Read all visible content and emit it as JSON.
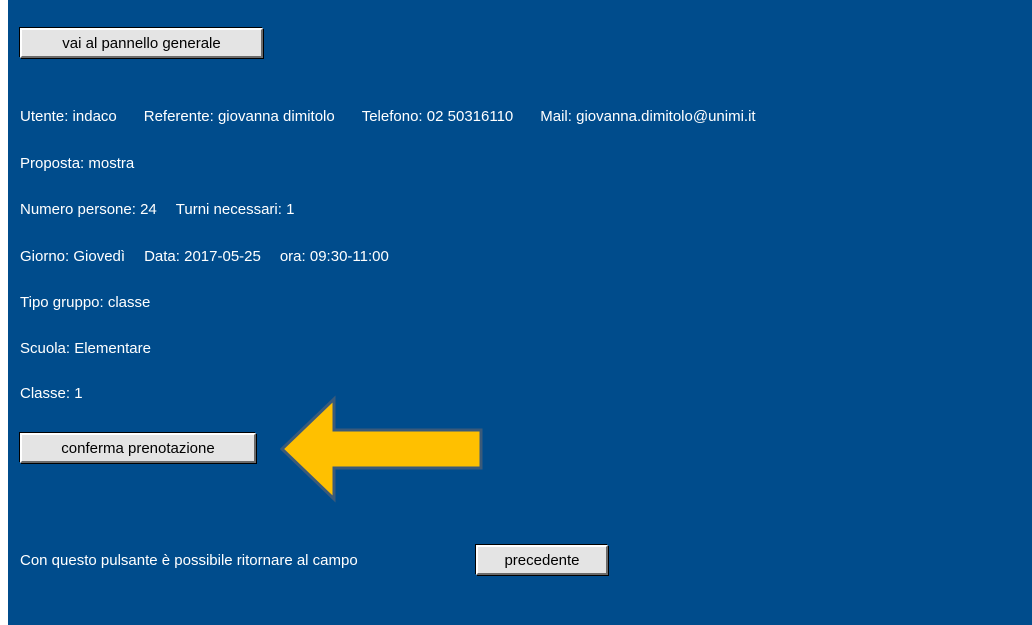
{
  "buttons": {
    "general_panel": "vai al pannello generale",
    "confirm": "conferma prenotazione",
    "previous": "precedente"
  },
  "info": {
    "utente": {
      "label": "Utente:",
      "value": "indaco"
    },
    "referente": {
      "label": "Referente:",
      "value": "giovanna dimitolo"
    },
    "telefono": {
      "label": "Telefono:",
      "value": "02 50316110"
    },
    "mail": {
      "label": "Mail:",
      "value": "giovanna.dimitolo@unimi.it"
    },
    "proposta": {
      "label": "Proposta:",
      "value": "mostra"
    },
    "numero_persone": {
      "label": "Numero persone:",
      "value": "24"
    },
    "turni": {
      "label": "Turni necessari:",
      "value": "1"
    },
    "giorno": {
      "label": "Giorno:",
      "value": "Giovedì"
    },
    "data": {
      "label": "Data:",
      "value": "2017-05-25"
    },
    "ora": {
      "label": "ora:",
      "value": "09:30-11:00"
    },
    "tipo_gruppo": {
      "label": "Tipo gruppo:",
      "value": "classe"
    },
    "scuola": {
      "label": "Scuola:",
      "value": "Elementare"
    },
    "classe": {
      "label": "Classe:",
      "value": "1"
    }
  },
  "footer": {
    "text": "Con questo pulsante è possibile ritornare al campo"
  },
  "colors": {
    "background": "#004c8c",
    "arrow": "#ffc000"
  }
}
